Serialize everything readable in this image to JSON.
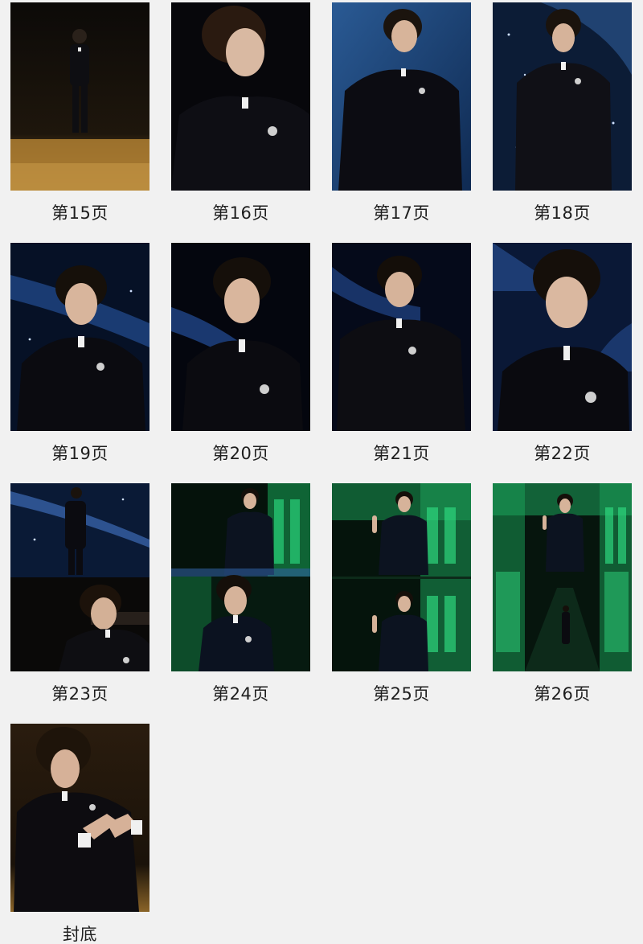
{
  "pages": [
    {
      "label": "第15页",
      "scene": "golden-stage-fullbody",
      "colors": {
        "bg": "#1a120a",
        "floor": "#a8782c"
      }
    },
    {
      "label": "第16页",
      "scene": "dark-portrait-upward",
      "colors": {
        "bg": "#06060a"
      }
    },
    {
      "label": "第17页",
      "scene": "blue-backdrop-walk",
      "colors": {
        "bg": "#2f5a8e"
      }
    },
    {
      "label": "第18页",
      "scene": "starry-blue-fullbody",
      "colors": {
        "bg": "#0d1f3a"
      }
    },
    {
      "label": "第19页",
      "scene": "starry-blue-halfbody",
      "colors": {
        "bg": "#07142c"
      }
    },
    {
      "label": "第20页",
      "scene": "blue-glow-portrait",
      "colors": {
        "bg": "#040610"
      }
    },
    {
      "label": "第21页",
      "scene": "blue-glow-halfbody",
      "colors": {
        "bg": "#060b1c"
      }
    },
    {
      "label": "第22页",
      "scene": "blue-glow-closeup",
      "colors": {
        "bg": "#0a1a3e"
      }
    },
    {
      "label": "第23页",
      "scene": "starry-split",
      "colors": {
        "bg": "#0a1a36"
      }
    },
    {
      "label": "第24页",
      "scene": "green-split",
      "colors": {
        "bg": "#06150d",
        "accent": "#1fc46c"
      }
    },
    {
      "label": "第25页",
      "scene": "green-wave",
      "colors": {
        "bg": "#06170f",
        "accent": "#23c46e"
      }
    },
    {
      "label": "第26页",
      "scene": "green-corridor",
      "colors": {
        "bg": "#07180f",
        "accent": "#2ad27a"
      }
    },
    {
      "label": "封底",
      "scene": "golden-seated-portrait",
      "colors": {
        "bg": "#1c140a",
        "floor": "#7a5a24"
      }
    }
  ]
}
